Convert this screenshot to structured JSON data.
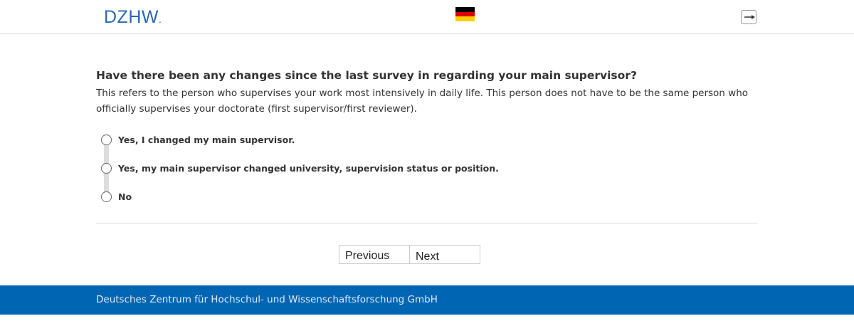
{
  "header": {
    "logo_text": "DZHW",
    "logo_suffix": ".",
    "language_flag_icon": "german-flag-icon",
    "logout_icon": "logout-icon",
    "colors": {
      "logo": "#2a68b4",
      "flag_black": "#000000",
      "flag_red": "#dd0000",
      "flag_gold": "#ffce00"
    }
  },
  "question": {
    "title": "Have there been any changes since the last survey in regarding your main supervisor?",
    "description": "This refers to the person who supervises your work most intensively in daily life. This person does not have to be the same person who officially supervises your doctorate (first supervisor/first reviewer).",
    "options": [
      {
        "label": "Yes, I changed my main supervisor."
      },
      {
        "label": "Yes, my main supervisor changed university, supervision status or position."
      },
      {
        "label": "No"
      }
    ]
  },
  "navigation": {
    "previous_label": "Previous",
    "next_label": "Next"
  },
  "footer": {
    "text": "Deutsches Zentrum für Hochschul- und Wissenschaftsforschung GmbH",
    "color": "#0066b3"
  }
}
